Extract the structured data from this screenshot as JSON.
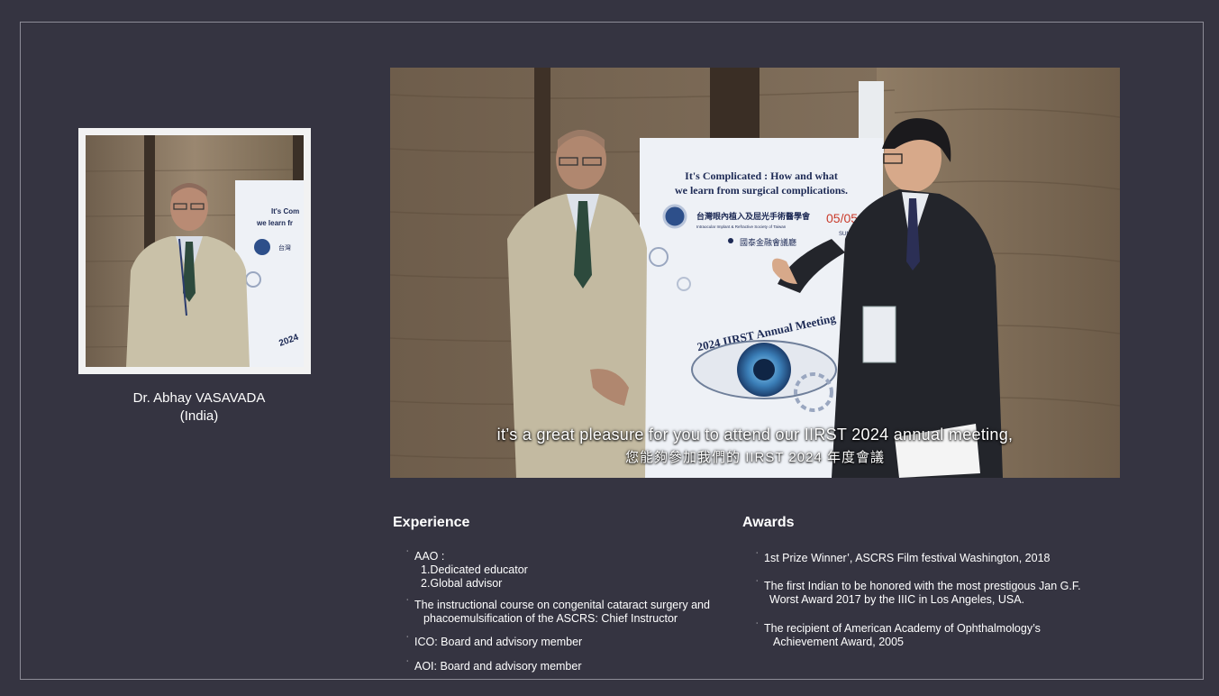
{
  "speaker": {
    "name": "Dr. Abhay VASAVADA",
    "country": "(India)"
  },
  "video": {
    "banner": {
      "headline_1": "It's Complicated : How and what",
      "headline_2": "we learn from surgical complications.",
      "society_zh": "台灣眼內植入及屈光手術醫學會",
      "society_en": "Intraocular Implant & Refractive Society of Taiwan",
      "date": "05/05",
      "weekday": "SUNDAY",
      "venue": "國泰金融會議廳",
      "meeting": "2024 IIRST Annual Meeting"
    },
    "thumbnail_banner": {
      "line_1": "It's Com",
      "line_2": "we learn fr",
      "society_zh": "台灣",
      "year": "2024"
    },
    "subtitle_en": "it’s a great pleasure for you to attend our IIRST 2024 annual meeting,",
    "subtitle_zh": "您能夠參加我們的 IIRST 2024 年度會議"
  },
  "experience": {
    "title": "Experience",
    "items": [
      {
        "text": "AAO :",
        "sub": [
          "1.Dedicated educator",
          "2.Global advisor"
        ]
      },
      {
        "text": "The instructional course on congenital cataract surgery and",
        "cont": "phacoemulsification of the ASCRS: Chief Instructor"
      },
      {
        "text": "ICO: Board and advisory member"
      },
      {
        "text": "AOI: Board and advisory member"
      }
    ]
  },
  "awards": {
    "title": "Awards",
    "items": [
      {
        "text": "1st Prize Winner’, ASCRS Film festival Washington, 2018"
      },
      {
        "text": "The first Indian to be honored with the most prestigous Jan G.F.",
        "cont": "Worst Award 2017 by the IIIC in Los Angeles, USA."
      },
      {
        "text": "The recipient of American Academy of Ophthalmology’s",
        "cont": "Achievement Award, 2005"
      }
    ]
  },
  "bullet_char": "˙"
}
